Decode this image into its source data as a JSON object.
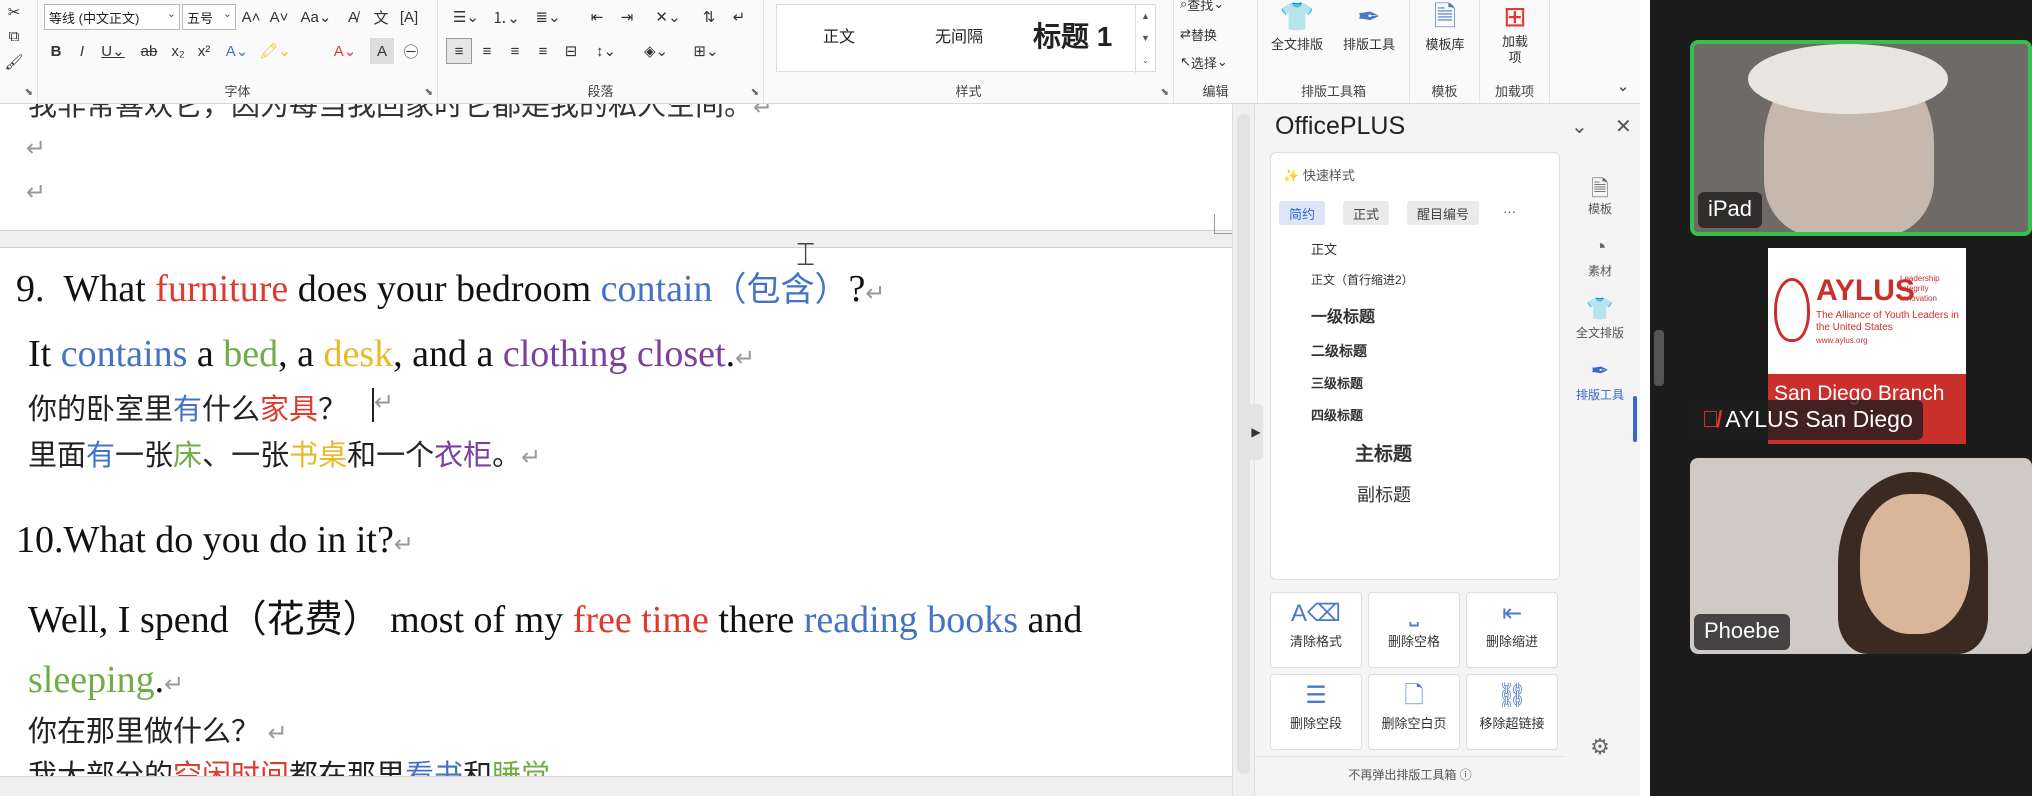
{
  "ribbon": {
    "font_name": "等线 (中文正文)",
    "font_size": "五号",
    "groups": {
      "font": "字体",
      "paragraph": "段落",
      "styles": "样式",
      "edit": "编辑",
      "layout_toolbox": "排版工具箱",
      "template": "模板",
      "addins": "加载项"
    },
    "style_gallery": [
      "正文",
      "无间隔",
      "标题 1"
    ],
    "edit_items": [
      "查找",
      "替换",
      "选择"
    ],
    "tools": {
      "full_layout": "全文排版",
      "layout_tool": "排版工具",
      "template_lib": "模板库",
      "addin": "加载项"
    }
  },
  "document": {
    "top_partial": "我非常喜欢它，因为每当我回家时它都是我的私人空间。",
    "q9": {
      "num": "9.",
      "w1": "What",
      "w2": "furniture",
      "w3": "does your bedroom",
      "w4": "contain",
      "w5": "（包含）",
      "w6": "?"
    },
    "a9": {
      "w1": "It",
      "w2": "contains",
      "w3": "a",
      "w4": "bed",
      "w5": ", a",
      "w6": "desk",
      "w7": ", and a",
      "w8": "clothing closet",
      "w9": "."
    },
    "q9_cn": {
      "w1": "你的卧室里",
      "w2": "有",
      "w3": "什么",
      "w4": "家具",
      "w5": "？"
    },
    "a9_cn": {
      "w1": "里面",
      "w2": "有",
      "w3": "一张",
      "w4": "床",
      "w5": "、一张",
      "w6": "书桌",
      "w7": "和一个",
      "w8": "衣柜",
      "w9": "。"
    },
    "q10": "10.What do you do in it?",
    "a10": {
      "w1": "Well, I spend（花费）  most of my",
      "w2": "free time",
      "w3": "there",
      "w4": "reading books",
      "w5": "and",
      "w6": "sleeping",
      "w7": "."
    },
    "q10_cn": "你在那里做什么？",
    "bottom_partial": {
      "w1": "我大部分的",
      "w2": "空闲时间",
      "w3": "都在那里",
      "w4": "看书",
      "w5": "和",
      "w6": "睡觉",
      "w7": "。"
    }
  },
  "panel": {
    "title": "OfficePLUS",
    "quick_style": "快速样式",
    "chips": [
      "简约",
      "正式",
      "醒目编号"
    ],
    "more": "···",
    "styles": [
      "正文",
      "正文（首行缩进2）",
      "一级标题",
      "二级标题",
      "三级标题",
      "四级标题",
      "主标题",
      "副标题"
    ],
    "tools": [
      "清除格式",
      "删除空格",
      "删除缩进",
      "删除空段",
      "删除空白页",
      "移除超链接"
    ],
    "footer": "不再弹出排版工具箱 ⓘ",
    "rail": [
      "模板",
      "素材",
      "全文排版",
      "排版工具"
    ]
  },
  "video": {
    "participants": [
      {
        "name": "iPad",
        "active": true
      },
      {
        "name": "AYLUS San Diego",
        "muted": true
      },
      {
        "name": "Phoebe"
      }
    ],
    "logo": {
      "brand": "AYLUS",
      "tagline": "Leadership Integrity Innovation",
      "subtitle": "The Alliance of Youth Leaders in the United States",
      "site": "www.aylus.org",
      "branch": "San Diego Branch"
    }
  },
  "colors": {
    "red": "#e03a2f",
    "blue": "#4472c4",
    "green": "#70ad47",
    "yellow": "#e8b928",
    "purple": "#7b3fa0",
    "accent": "#3a66c4",
    "active_speaker": "#35c24a"
  }
}
